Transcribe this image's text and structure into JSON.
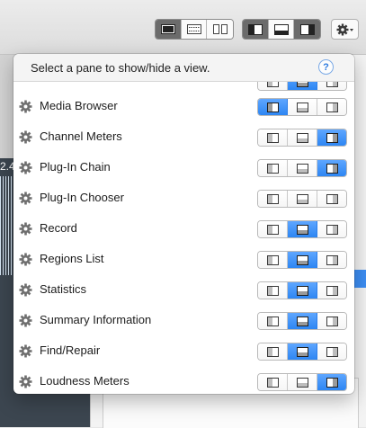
{
  "popover": {
    "title": "Select a pane to show/hide a view.",
    "help_label": "?"
  },
  "background": {
    "side_text": "2.4"
  },
  "layout_options": [
    "left-pane",
    "bottom-pane",
    "right-pane"
  ],
  "views": [
    {
      "label": "",
      "selected": "bottom-pane",
      "partial": true
    },
    {
      "label": "Media Browser",
      "selected": "left-pane"
    },
    {
      "label": "Channel Meters",
      "selected": "right-pane"
    },
    {
      "label": "Plug-In Chain",
      "selected": "right-pane"
    },
    {
      "label": "Plug-In Chooser",
      "selected": null
    },
    {
      "label": "Record",
      "selected": "bottom-pane"
    },
    {
      "label": "Regions List",
      "selected": "bottom-pane"
    },
    {
      "label": "Statistics",
      "selected": "bottom-pane"
    },
    {
      "label": "Summary Information",
      "selected": "bottom-pane"
    },
    {
      "label": "Find/Repair",
      "selected": "bottom-pane"
    },
    {
      "label": "Loudness Meters",
      "selected": "right-pane"
    }
  ],
  "colors": {
    "accent": "#2d86f3",
    "dark_segment": "#6b6b6b",
    "sidebar": "#3c4650"
  }
}
